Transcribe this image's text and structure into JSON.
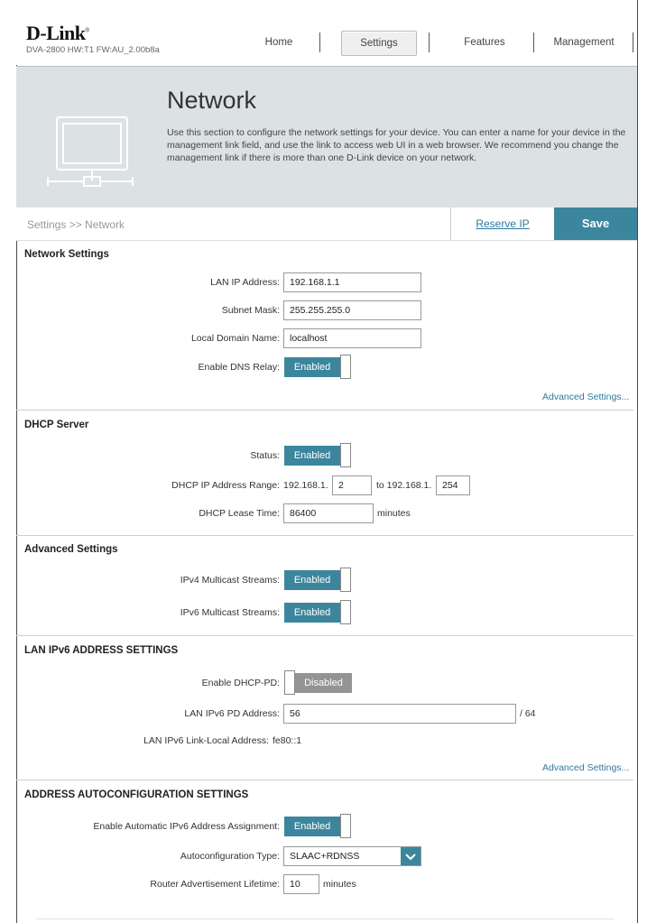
{
  "header": {
    "brand": "D-Link",
    "model_info": "DVA-2800   HW:T1   FW:AU_2.00b8a",
    "nav": [
      {
        "label": "Home"
      },
      {
        "label": "Settings"
      },
      {
        "label": "Features"
      },
      {
        "label": "Management"
      }
    ],
    "active_nav": "Settings"
  },
  "banner": {
    "title": "Network",
    "description": "Use this section to configure the network settings for your device. You can enter a name for your device in the management link field, and use the link to access web UI in a web browser. We recommend you change the management link if there is more than one D-Link device on your network.",
    "icon": "computer-network-icon"
  },
  "toolbar": {
    "breadcrumb": "Settings >> Network",
    "reserve_ip_label": "Reserve IP",
    "save_label": "Save"
  },
  "network_settings": {
    "title": "Network Settings",
    "lan_ip_label": "LAN IP Address:",
    "lan_ip_value": "192.168.1.1",
    "subnet_label": "Subnet Mask:",
    "subnet_value": "255.255.255.0",
    "domain_label": "Local Domain Name:",
    "domain_value": "localhost",
    "dns_relay_label": "Enable DNS Relay:",
    "dns_relay_state": "Enabled",
    "advanced_link": "Advanced Settings..."
  },
  "dhcp_server": {
    "title": "DHCP Server",
    "status_label": "Status:",
    "status_state": "Enabled",
    "range_label": "DHCP IP Address Range:",
    "range_prefix_start": "192.168.1.",
    "range_start": "2",
    "range_to": "to 192.168.1.",
    "range_end": "254",
    "lease_label": "DHCP Lease Time:",
    "lease_value": "86400",
    "lease_unit": "minutes"
  },
  "advanced_settings": {
    "title": "Advanced Settings",
    "ipv4_label": "IPv4 Multicast Streams:",
    "ipv4_state": "Enabled",
    "ipv6_label": "IPv6 Multicast Streams:",
    "ipv6_state": "Enabled"
  },
  "lan_ipv6": {
    "title": "LAN IPv6 ADDRESS SETTINGS",
    "dhcp_pd_label": "Enable DHCP-PD:",
    "dhcp_pd_state": "Disabled",
    "pd_address_label": "LAN IPv6 PD Address:",
    "pd_address_value": "56",
    "pd_suffix": "/ 64",
    "link_local_label": "LAN IPv6 Link-Local Address:",
    "link_local_value": "fe80::1",
    "advanced_link": "Advanced Settings..."
  },
  "autoconfig": {
    "title": "ADDRESS AUTOCONFIGURATION SETTINGS",
    "auto_assign_label": "Enable Automatic IPv6 Address Assignment:",
    "auto_assign_state": "Enabled",
    "type_label": "Autoconfiguration Type:",
    "type_value": "SLAAC+RDNSS",
    "lifetime_label": "Router Advertisement Lifetime:",
    "lifetime_value": "10",
    "lifetime_unit": "minutes"
  },
  "colors": {
    "accent": "#3c869d",
    "toggle_off": "#949494",
    "banner_bg": "#dce1e4",
    "link": "#2e7aa0"
  }
}
